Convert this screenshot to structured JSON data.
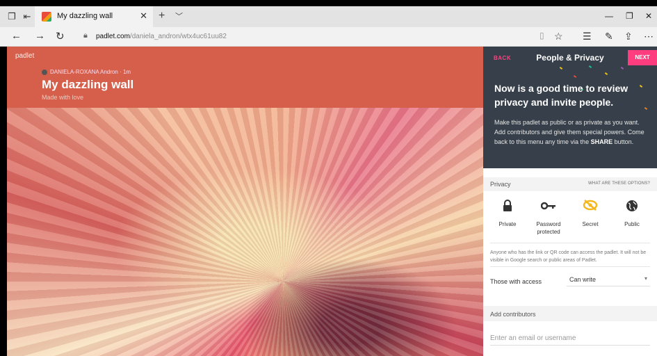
{
  "browser": {
    "tab_title": "My dazzling wall",
    "url_host": "padlet.com",
    "url_path": "/daniela_andron/wtx4uc61uu82",
    "icons": [
      "tab-preview-icon",
      "set-aside-icon",
      "padlet-favicon",
      "close-icon",
      "new-tab-icon",
      "tab-list-icon",
      "minimize-icon",
      "restore-icon",
      "window-close-icon",
      "back-icon",
      "forward-icon",
      "refresh-icon",
      "lock-icon",
      "reading-view-icon",
      "favorite-star-icon",
      "favorites-hub-icon",
      "web-note-icon",
      "share-icon",
      "more-icon"
    ]
  },
  "padlet": {
    "brand": "padlet",
    "author": "DANIELA-ROXANA Andron",
    "time_ago": "1m",
    "title": "My dazzling wall",
    "subtitle": "Made with love",
    "header_color": "#d55f4b"
  },
  "panel": {
    "back_label": "BACK",
    "title": "People & Privacy",
    "next_label": "NEXT",
    "hero": "Now is a good time to review privacy and invite people.",
    "desc_prefix": "Make this padlet as public or as private as you want. Add contributors and give them special powers. Come back to this menu any time via the ",
    "desc_bold": "SHARE",
    "desc_suffix": " button.",
    "privacy_label": "Privacy",
    "what_link": "WHAT ARE THESE OPTIONS?",
    "options": [
      {
        "label": "Private",
        "icon": "padlock-icon"
      },
      {
        "label": "Password protected",
        "icon": "key-icon"
      },
      {
        "label": "Secret",
        "icon": "eye-slash-icon"
      },
      {
        "label": "Public",
        "icon": "globe-icon"
      }
    ],
    "selected_option": "Secret",
    "access_note": "Anyone who has the link or QR code can access the padlet. It will not be visible in Google search or public areas of Padlet.",
    "access_label": "Those with access",
    "access_value": "Can write",
    "contributors_label": "Add contributors",
    "contributors_placeholder": "Enter an email or username",
    "accent_color": "#ff3d7f",
    "panel_dark_color": "#37404a",
    "selected_color": "#f5b81c"
  }
}
